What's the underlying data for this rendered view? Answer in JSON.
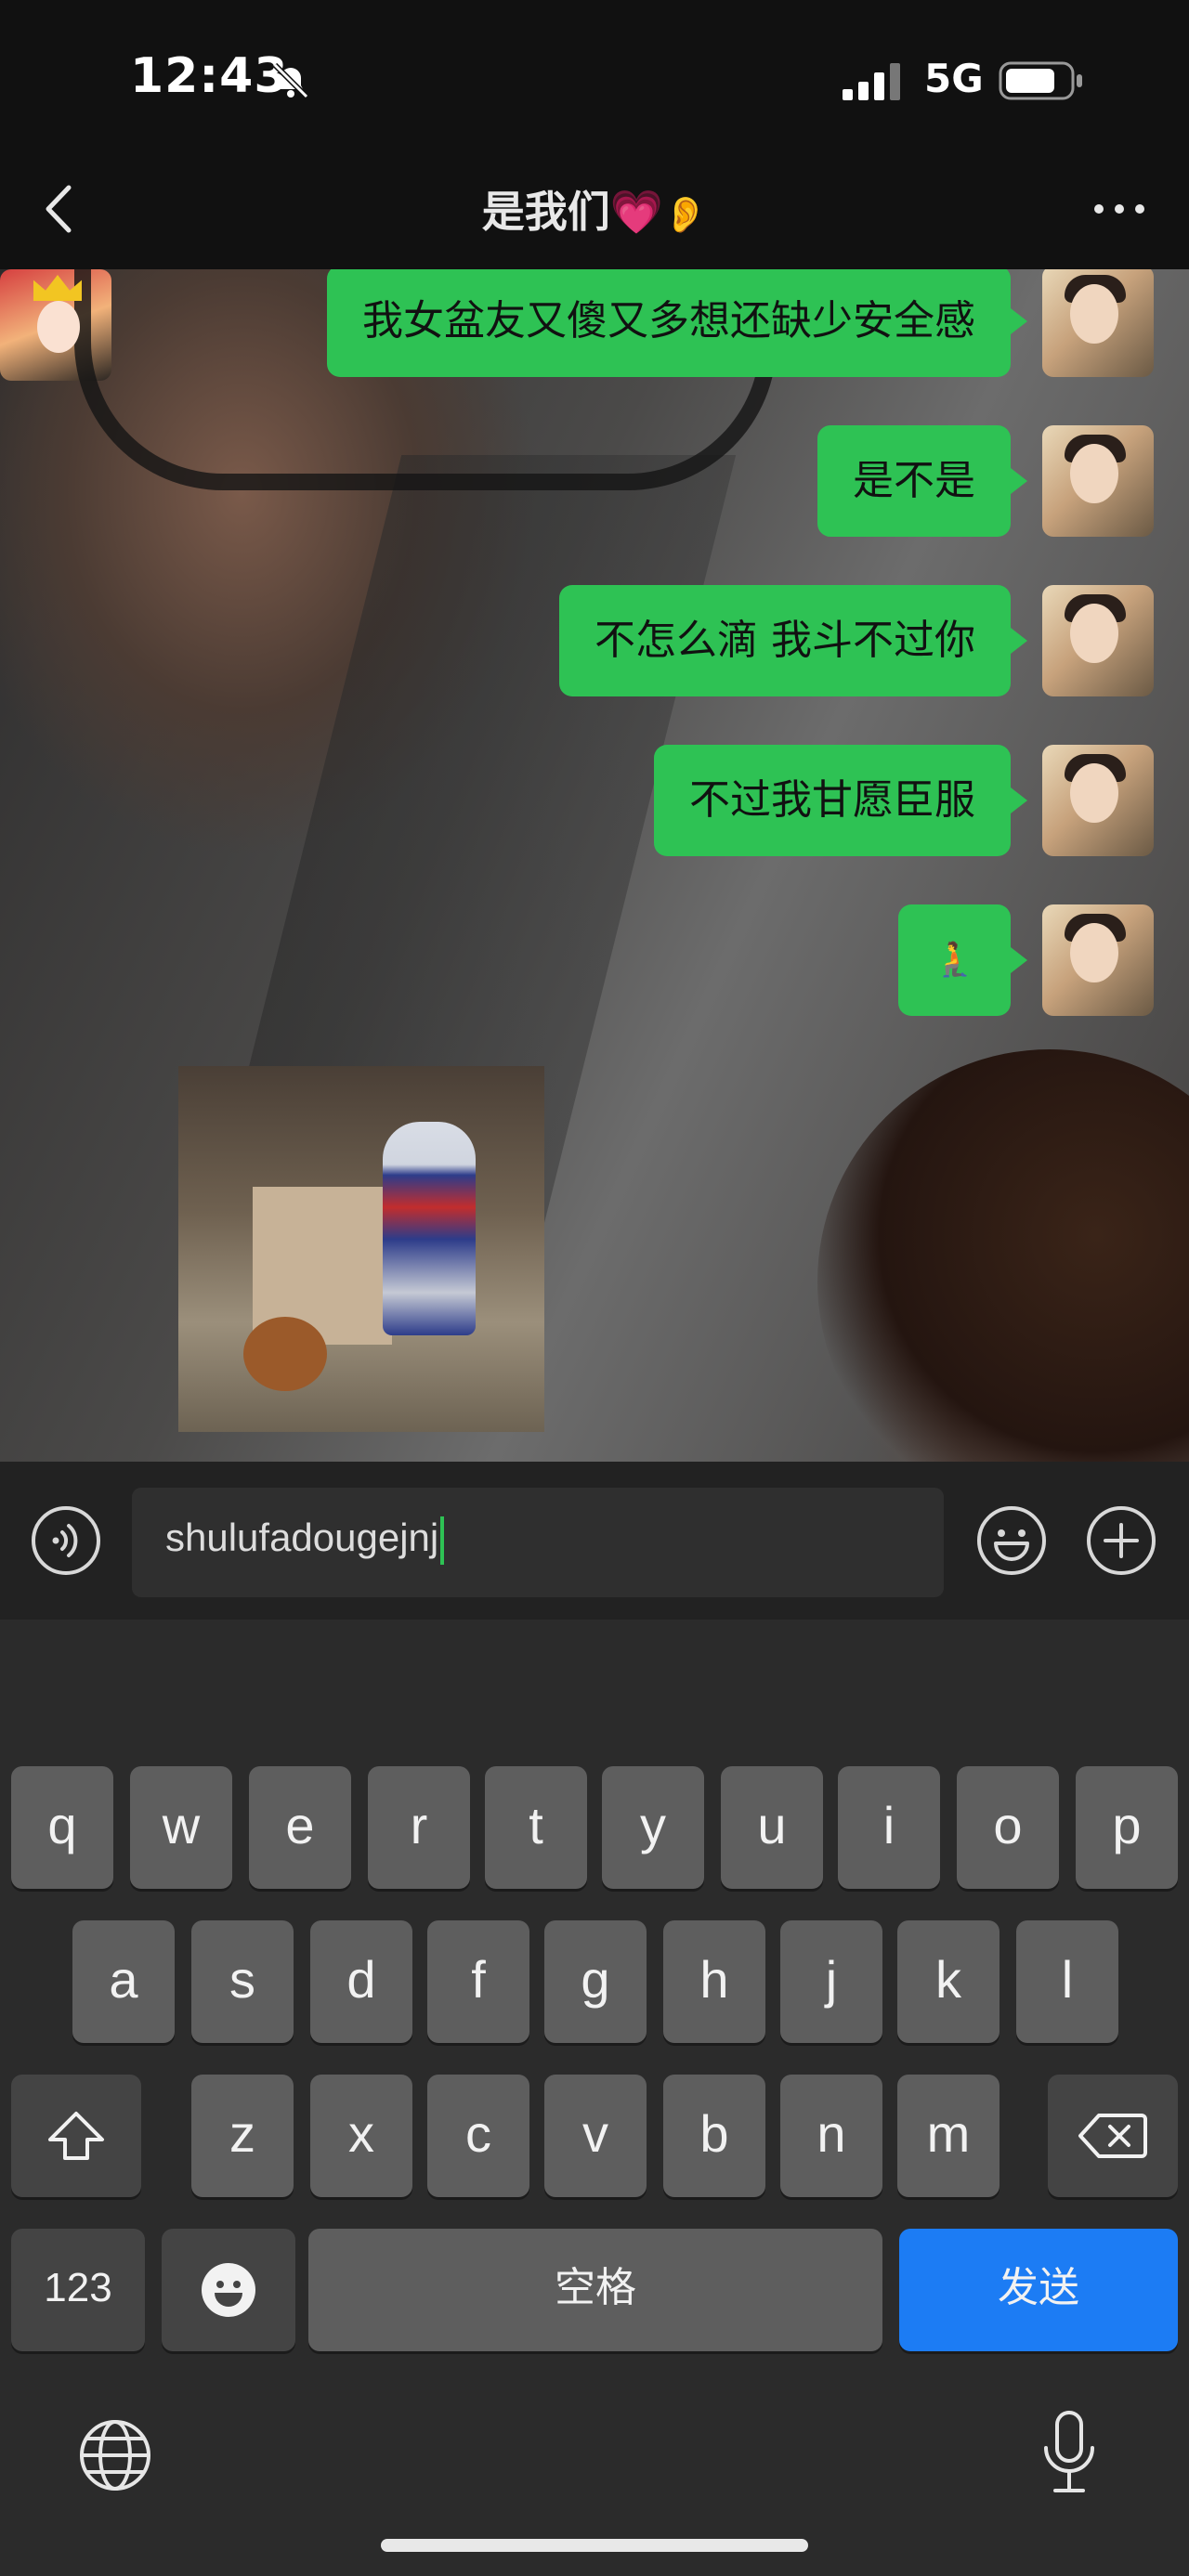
{
  "status": {
    "time": "12:43",
    "network": "5G"
  },
  "nav": {
    "title": "是我们",
    "heart": "💗",
    "ear": "👂"
  },
  "messages": [
    {
      "text": "我女盆友又傻又多想还缺少安全感"
    },
    {
      "text": "是不是"
    },
    {
      "text": "不怎么滴 我斗不过你"
    },
    {
      "text": "不过我甘愿臣服"
    },
    {
      "text": "🧎"
    }
  ],
  "input": {
    "value": "shulufadougejnj"
  },
  "keyboard": {
    "row1": [
      "q",
      "w",
      "e",
      "r",
      "t",
      "y",
      "u",
      "i",
      "o",
      "p"
    ],
    "row2": [
      "a",
      "s",
      "d",
      "f",
      "g",
      "h",
      "j",
      "k",
      "l"
    ],
    "row3": [
      "z",
      "x",
      "c",
      "v",
      "b",
      "n",
      "m"
    ],
    "numbers_label": "123",
    "space_label": "空格",
    "send_label": "发送"
  }
}
